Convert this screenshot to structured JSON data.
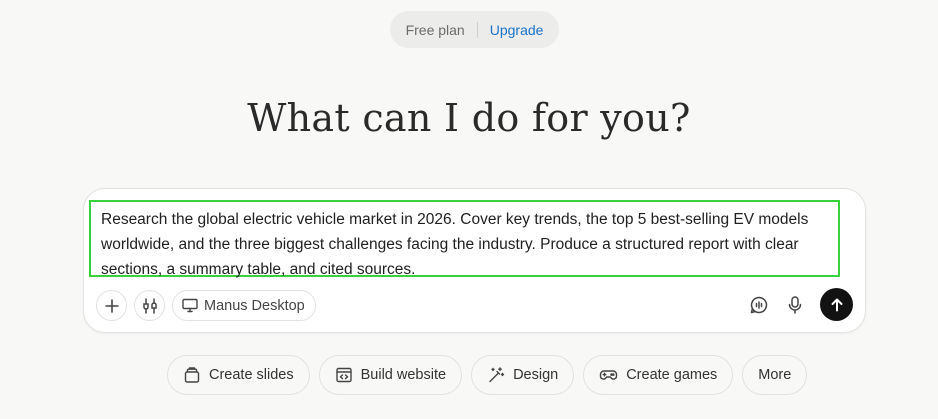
{
  "plan": {
    "current": "Free plan",
    "upgrade_label": "Upgrade"
  },
  "headline": "What can I do for you?",
  "composer": {
    "prompt_text": "Research the global electric vehicle market in 2026. Cover key trends, the top 5 best-selling EV models worldwide, and the three biggest challenges facing the industry. Produce a structured report with clear sections, a summary table, and cited sources.",
    "tools": [
      {
        "icon": "plus-icon"
      },
      {
        "icon": "connectors-icon"
      }
    ],
    "desktop_label": "Manus Desktop",
    "right_icons": [
      "voice-chat-icon",
      "microphone-icon",
      "arrow-up-icon"
    ]
  },
  "suggestions": [
    {
      "label": "Create slides",
      "icon": "slides-icon"
    },
    {
      "label": "Build website",
      "icon": "website-icon"
    },
    {
      "label": "Design",
      "icon": "magic-wand-icon"
    },
    {
      "label": "Create games",
      "icon": "gamepad-icon"
    },
    {
      "label": "More",
      "icon": ""
    }
  ],
  "colors": {
    "accent_link": "#1a73c9",
    "highlight_border": "#3ad23a",
    "send_button": "#121212"
  }
}
